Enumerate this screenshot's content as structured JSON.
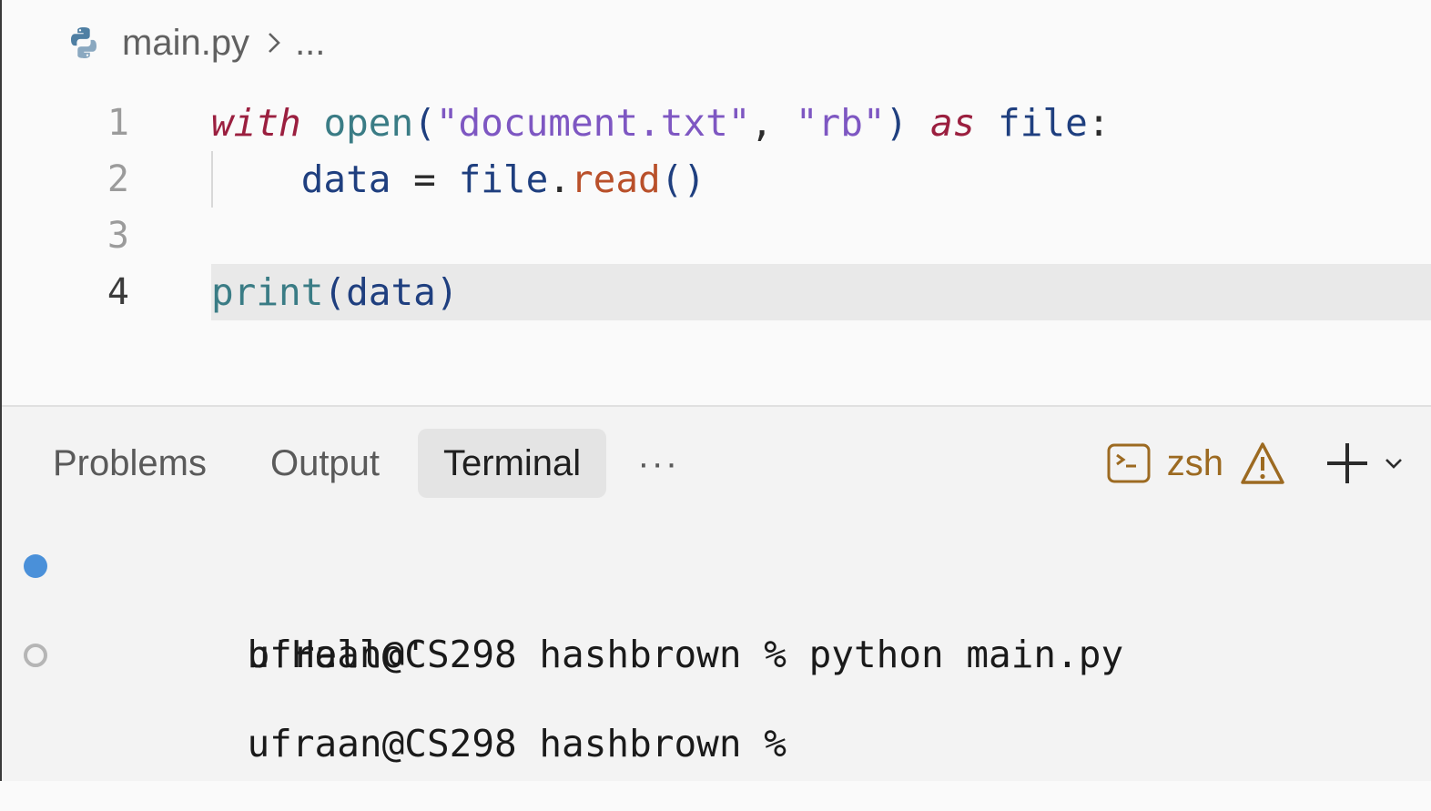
{
  "breadcrumb": {
    "file_icon": "python-icon",
    "file": "main.py",
    "separator_icon": "chevron-right-icon",
    "trail": "..."
  },
  "editor": {
    "current_line": 4,
    "lines": [
      {
        "number": "1",
        "text": "with open(\"document.txt\", \"rb\") as file:"
      },
      {
        "number": "2",
        "text": "    data = file.read()"
      },
      {
        "number": "3",
        "text": ""
      },
      {
        "number": "4",
        "text": "print(data)"
      }
    ],
    "tokens": {
      "l1": [
        "with",
        " ",
        "open",
        "(",
        "\"document.txt\"",
        ", ",
        "\"rb\"",
        ")",
        " ",
        "as",
        " ",
        "file",
        ":"
      ],
      "l2": [
        "    ",
        "data",
        " = ",
        "file",
        ".",
        "read",
        "()"
      ],
      "l4": [
        "print",
        "(",
        "data",
        ")"
      ]
    }
  },
  "panel": {
    "tabs": [
      {
        "label": "Problems",
        "active": false
      },
      {
        "label": "Output",
        "active": false
      },
      {
        "label": "Terminal",
        "active": true
      },
      {
        "label": "···",
        "active": false
      }
    ],
    "shell": {
      "icon": "terminal-icon",
      "name": "zsh",
      "warning_icon": "warning-icon",
      "accent": "#9c6a21"
    },
    "add_icon": "plus-icon",
    "dropdown_icon": "chevron-down-icon"
  },
  "terminal": {
    "lines": [
      {
        "marker": "filled",
        "text": "ufraan@CS298 hashbrown % python main.py"
      },
      {
        "marker": "none",
        "text": "b'Hello'"
      },
      {
        "marker": "hollow",
        "text": "ufraan@CS298 hashbrown % "
      }
    ],
    "marker_colors": {
      "success": "#4a90d9",
      "idle": "#b5b5b5"
    }
  }
}
